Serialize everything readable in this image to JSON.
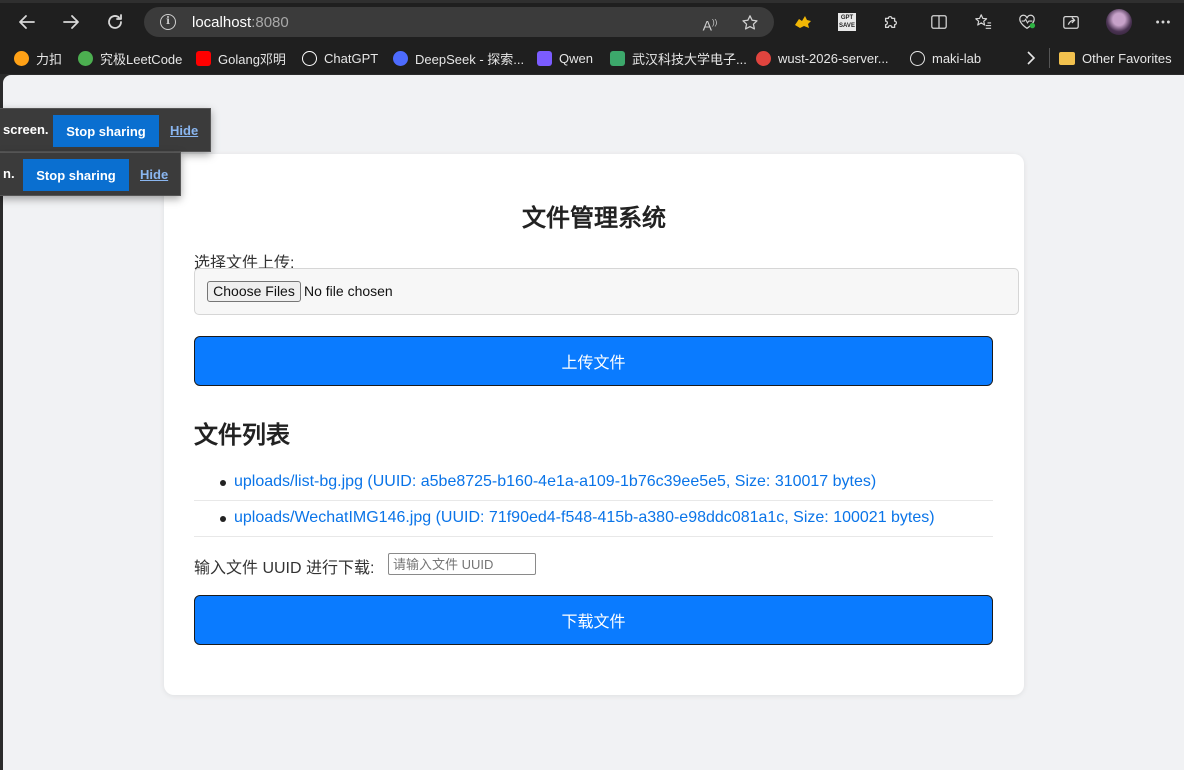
{
  "browser": {
    "url_host": "localhost",
    "url_port": ":8080",
    "bookmarks": [
      {
        "label": "力扣",
        "color": "#ffa116"
      },
      {
        "label": "究极LeetCode",
        "color": "#4caf50"
      },
      {
        "label": "Golang邓明",
        "color": "#ff0000"
      },
      {
        "label": "ChatGPT",
        "color": "#ffffff"
      },
      {
        "label": "DeepSeek - 探索...",
        "color": "#4d6bfe"
      },
      {
        "label": "Qwen",
        "color": "#7b5cff"
      },
      {
        "label": "武汉科技大学电子...",
        "color": "#3ca86b"
      },
      {
        "label": "wust-2026-server...",
        "color": "#e0443e"
      },
      {
        "label": "maki-lab",
        "color": "#1f1f1f"
      }
    ],
    "other_favorites": "Other Favorites"
  },
  "share_bars": [
    {
      "text": "screen.",
      "stop_label": "Stop sharing",
      "hide_label": "Hide"
    },
    {
      "text": "n.",
      "stop_label": "Stop sharing",
      "hide_label": "Hide"
    }
  ],
  "page": {
    "title": "文件管理系统",
    "upload_label": "选择文件上传:",
    "choose_files_label": "Choose Files",
    "no_file_text": "No file chosen",
    "upload_button": "上传文件",
    "file_list_heading": "文件列表",
    "files": [
      {
        "text": "uploads/list-bg.jpg (UUID: a5be8725-b160-4e1a-a109-1b76c39ee5e5, Size: 310017 bytes)"
      },
      {
        "text": "uploads/WechatIMG146.jpg (UUID: 71f90ed4-f548-415b-a380-e98ddc081a1c, Size: 100021 bytes)"
      }
    ],
    "download_label": "输入文件 UUID 进行下载:",
    "uuid_placeholder": "请输入文件 UUID",
    "download_button": "下载文件"
  }
}
